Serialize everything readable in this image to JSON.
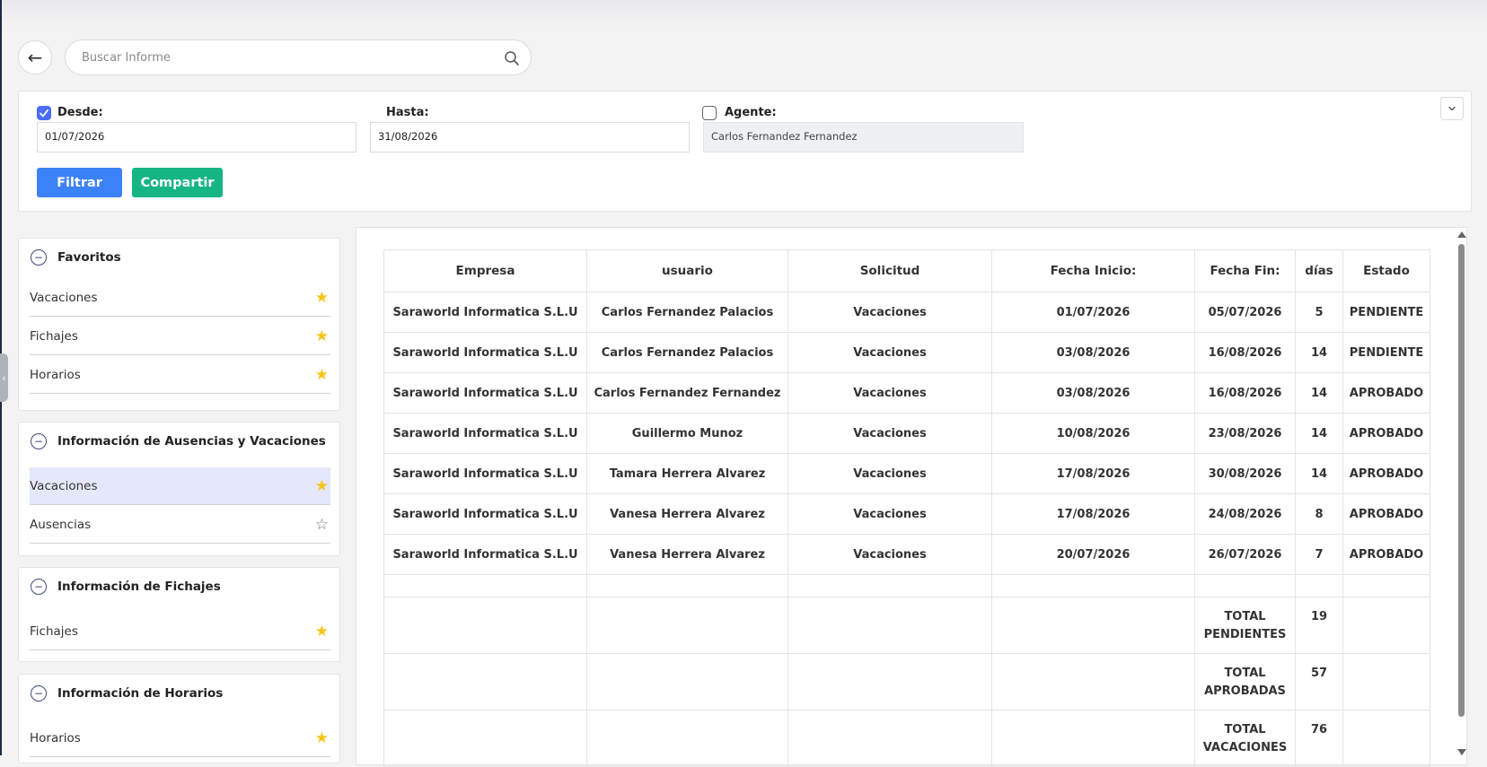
{
  "search": {
    "placeholder": "Buscar Informe"
  },
  "back_label": "←",
  "filters": {
    "desde_label": "Desde:",
    "desde_value": "01/07/2026",
    "desde_checked": true,
    "hasta_label": "Hasta:",
    "hasta_value": "31/08/2026",
    "agente_label": "Agente:",
    "agente_value": "Carlos Fernandez Fernandez",
    "agente_checked": false,
    "filtrar_label": "Filtrar",
    "compartir_label": "Compartir"
  },
  "sidebar": {
    "groups": [
      {
        "title": "Favoritos",
        "items": [
          {
            "label": "Vacaciones",
            "star": "filled"
          },
          {
            "label": "Fichajes",
            "star": "filled"
          },
          {
            "label": "Horarios",
            "star": "filled"
          }
        ]
      },
      {
        "title": "Información de Ausencias y Vacaciones",
        "items": [
          {
            "label": "Vacaciones",
            "star": "filled",
            "selected": true
          },
          {
            "label": "Ausencias",
            "star": "empty"
          }
        ]
      },
      {
        "title": "Información de Fichajes",
        "items": [
          {
            "label": "Fichajes",
            "star": "filled"
          }
        ]
      },
      {
        "title": "Información de Horarios",
        "items": [
          {
            "label": "Horarios",
            "star": "filled"
          }
        ]
      }
    ]
  },
  "table": {
    "headers": [
      "Empresa",
      "usuario",
      "Solicitud",
      "Fecha Inicio:",
      "Fecha Fin:",
      "días",
      "Estado"
    ],
    "rows": [
      [
        "Saraworld Informatica S.L.U",
        "Carlos Fernandez Palacios",
        "Vacaciones",
        "01/07/2026",
        "05/07/2026",
        "5",
        "PENDIENTE"
      ],
      [
        "Saraworld Informatica S.L.U",
        "Carlos Fernandez Palacios",
        "Vacaciones",
        "03/08/2026",
        "16/08/2026",
        "14",
        "PENDIENTE"
      ],
      [
        "Saraworld Informatica S.L.U",
        "Carlos Fernandez Fernandez",
        "Vacaciones",
        "03/08/2026",
        "16/08/2026",
        "14",
        "APROBADO"
      ],
      [
        "Saraworld Informatica S.L.U",
        "Guillermo Munoz",
        "Vacaciones",
        "10/08/2026",
        "23/08/2026",
        "14",
        "APROBADO"
      ],
      [
        "Saraworld Informatica S.L.U",
        "Tamara Herrera Alvarez",
        "Vacaciones",
        "17/08/2026",
        "30/08/2026",
        "14",
        "APROBADO"
      ],
      [
        "Saraworld Informatica S.L.U",
        "Vanesa Herrera Alvarez",
        "Vacaciones",
        "17/08/2026",
        "24/08/2026",
        "8",
        "APROBADO"
      ],
      [
        "Saraworld Informatica S.L.U",
        "Vanesa Herrera Alvarez",
        "Vacaciones",
        "20/07/2026",
        "26/07/2026",
        "7",
        "APROBADO"
      ]
    ],
    "totals": [
      {
        "label_line1": "TOTAL",
        "label_line2": "PENDIENTES",
        "value": "19"
      },
      {
        "label_line1": "TOTAL",
        "label_line2": "APROBADAS",
        "value": "57"
      },
      {
        "label_line1": "TOTAL",
        "label_line2": "VACACIONES",
        "value": "76"
      }
    ]
  },
  "colors": {
    "primary": "#3b82f6",
    "success": "#16b683",
    "checkbox": "#4a6cf7",
    "star": "#f5c518",
    "selected_bg": "#e5e8fb"
  },
  "icons": {
    "search": "search-icon",
    "back": "arrow-left-icon",
    "collapse": "chevron-down-icon",
    "group_toggle": "minus-circle-icon"
  }
}
